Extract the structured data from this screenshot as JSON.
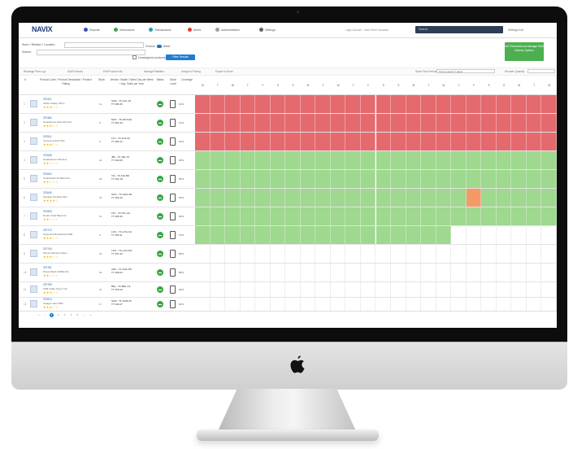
{
  "app": {
    "logo": "NAVIX",
    "nav": [
      {
        "label": "Reports",
        "color": "#3b4fb6"
      },
      {
        "label": "Instructions",
        "color": "#43a047"
      },
      {
        "label": "Transactions",
        "color": "#26a0b5"
      },
      {
        "label": "Alerts",
        "color": "#e53935"
      },
      {
        "label": "Administration",
        "color": "#9e9e9e"
      },
      {
        "label": "Settings",
        "color": "#616161"
      }
    ],
    "user_info": "Login Account - Juan Perez Gonzalez",
    "search_placeholder": "Search",
    "account_menu": "Settings Exit"
  },
  "filters": {
    "store_label": "Store / Retailer / Location",
    "search_label": "Search",
    "choose_label": "Choose",
    "choose_option": "Week",
    "checkbox_label": "Unassigned products",
    "filter_button": "Filter Results",
    "green_button": "Set Thresholds and Manage SMS Delivery Options"
  },
  "toolbar": {
    "items": [
      "Reassign Plan-o-gr",
      "Edit Products",
      "Edit Product Info",
      "Manage Retailers",
      "Assign to Pricing",
      "Export to Excel"
    ],
    "select_label": "Stock Flow Periodicity",
    "select_value": "Once a week (7 days)",
    "select2_label": "Reorder Quantity"
  },
  "table": {
    "headers": [
      "#",
      "Product Code / Product Description / Product Rating",
      "Stock",
      "Vendor / Model / Sales Day per Week / Avg. Sales per Year",
      "Status",
      "Stock Level",
      "Coverage"
    ],
    "day_headers": [
      "M",
      "T",
      "W",
      "T",
      "F",
      "S",
      "S",
      "M",
      "T",
      "W",
      "T",
      "F",
      "S",
      "S",
      "M",
      "T",
      "W",
      "T",
      "F",
      "S",
      "S",
      "M",
      "T",
      "W"
    ],
    "rows": [
      {
        "num": "1",
        "name": "370421",
        "desc": "Tablet Galaxy Tab A",
        "stars": "★★★☆☆",
        "stock": "12",
        "vendor": "SAM - TF-GAL-20",
        "model": "TT 280-35",
        "pct": "10%",
        "tone": "red"
      },
      {
        "num": "2",
        "name": "370482",
        "desc": "Smartphone Moto E6 Plus",
        "stars": "★★★☆☆",
        "stock": "8",
        "vendor": "MOT - TF-MOT-E6",
        "model": "TT 281-40",
        "pct": "12%",
        "tone": "red"
      },
      {
        "num": "3",
        "name": "370511",
        "desc": "Camera Instant Mini",
        "stars": "★★★☆☆",
        "stock": "5",
        "vendor": "FUJ - TF-FUJ-09",
        "model": "TT 282-12",
        "pct": "15%",
        "tone": "red"
      },
      {
        "num": "4",
        "name": "370538",
        "desc": "Headphones Wireless",
        "stars": "★★☆☆☆",
        "stock": "22",
        "vendor": "JBL - TF-JBL-T5",
        "model": "TT 290-05",
        "pct": "45%",
        "tone": "green"
      },
      {
        "num": "5",
        "name": "370602",
        "desc": "Smartwatch Fit Band Pro",
        "stars": "★★☆☆☆",
        "stock": "30",
        "vendor": "XIA - TF-XIA-BD",
        "model": "TT 291-18",
        "pct": "55%",
        "tone": "green"
      },
      {
        "num": "6",
        "name": "370645",
        "desc": "Speaker Portable Mini",
        "stars": "★★★★☆",
        "stock": "18",
        "vendor": "SON - TF-SON-XB",
        "model": "TT 293-22",
        "pct": "60%",
        "tone": "green_orange"
      },
      {
        "num": "7",
        "name": "370690",
        "desc": "Router Dual Band AC",
        "stars": "★★☆☆☆",
        "stock": "14",
        "vendor": "TPL - TF-TPL-AC",
        "model": "TT 295-30",
        "pct": "62%",
        "tone": "green"
      },
      {
        "num": "8",
        "name": "370712",
        "desc": "Keyboard Mechanical RGB",
        "stars": "★★★☆☆",
        "stock": "9",
        "vendor": "LOG - TF-LOG-G4",
        "model": "TT 296-11",
        "pct": "70%",
        "tone": "green_short"
      },
      {
        "num": "9",
        "name": "370744",
        "desc": "Mouse Wireless Silent",
        "stars": "★★★☆☆",
        "stock": "26",
        "vendor": "LOG - TF-LOG-M3",
        "model": "TT 297-45",
        "pct": "80%",
        "tone": "white"
      },
      {
        "num": "10",
        "name": "370781",
        "desc": "Power Bank 10000mAh",
        "stars": "★★☆☆☆",
        "stock": "33",
        "vendor": "ANK - TF-ANK-PB",
        "model": "TT 298-02",
        "pct": "85%",
        "tone": "white"
      },
      {
        "num": "11",
        "name": "370799",
        "desc": "USB Cable Type C 2m",
        "stars": "★★★☆☆",
        "stock": "41",
        "vendor": "BEL - TF-BEL-C2",
        "model": "TT 299-19",
        "pct": "90%",
        "tone": "white"
      },
      {
        "num": "12",
        "name": "370813",
        "desc": "Charger Fast 25W",
        "stars": "★★★☆☆",
        "stock": "17",
        "vendor": "SAM - TF-SAM-25",
        "model": "TT 300-07",
        "pct": "92%",
        "tone": "white"
      }
    ]
  },
  "pager": {
    "pages": [
      "«",
      "‹",
      "1",
      "2",
      "3",
      "4",
      "5",
      "›",
      "»"
    ]
  },
  "colors": {
    "red": "#e46a6e",
    "green": "#9fd88f",
    "orange": "#f39a66",
    "white": "#ffffff"
  }
}
